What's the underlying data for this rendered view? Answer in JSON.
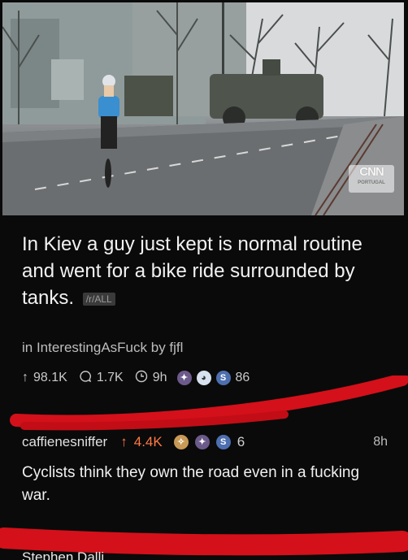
{
  "watermark": "CNN",
  "watermark_sub": "PORTUGAL",
  "post": {
    "title": "In Kiev a guy just kept is normal routine and went for a bike ride surrounded by tanks.",
    "subreddit_tag": "/r/ALL",
    "meta": "in InterestingAsFuck by fjfl",
    "upvotes": "98.1K",
    "comments": "1.7K",
    "age": "9h",
    "award_count": "86"
  },
  "comment": {
    "author": "caffienesniffer",
    "upvotes": "4.4K",
    "award_count": "6",
    "time": "8h",
    "body": "Cyclists think they own the road even in a fucking war."
  },
  "next_comment_author": "Stephen Dalli",
  "colors": {
    "background": "#0a0a0a",
    "scribble_red": "#d4101a",
    "upvote_orange": "#ff7a45"
  },
  "icons": [
    "upvote-arrow-icon",
    "comment-bubble-icon",
    "clock-icon",
    "award-icon"
  ]
}
